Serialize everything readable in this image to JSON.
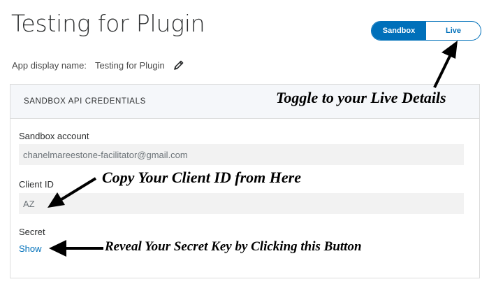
{
  "page": {
    "title": "Testing for Plugin"
  },
  "env_toggle": {
    "sandbox_label": "Sandbox",
    "live_label": "Live",
    "active": "Sandbox",
    "accent": "#0070ba"
  },
  "display_name": {
    "label": "App display name:",
    "value": "Testing for Plugin",
    "edit_icon": "pencil-icon"
  },
  "credentials": {
    "header": "SANDBOX API CREDENTIALS",
    "sandbox_account": {
      "label": "Sandbox account",
      "value": "chanelmareestone-facilitator@gmail.com"
    },
    "client_id": {
      "label": "Client ID",
      "value": "AZ"
    },
    "secret": {
      "label": "Secret",
      "show_label": "Show"
    }
  },
  "annotations": {
    "toggle": "Toggle to your Live Details",
    "client_id": "Copy Your Client ID from Here",
    "secret": "Reveal Your Secret Key by Clicking this Button"
  }
}
